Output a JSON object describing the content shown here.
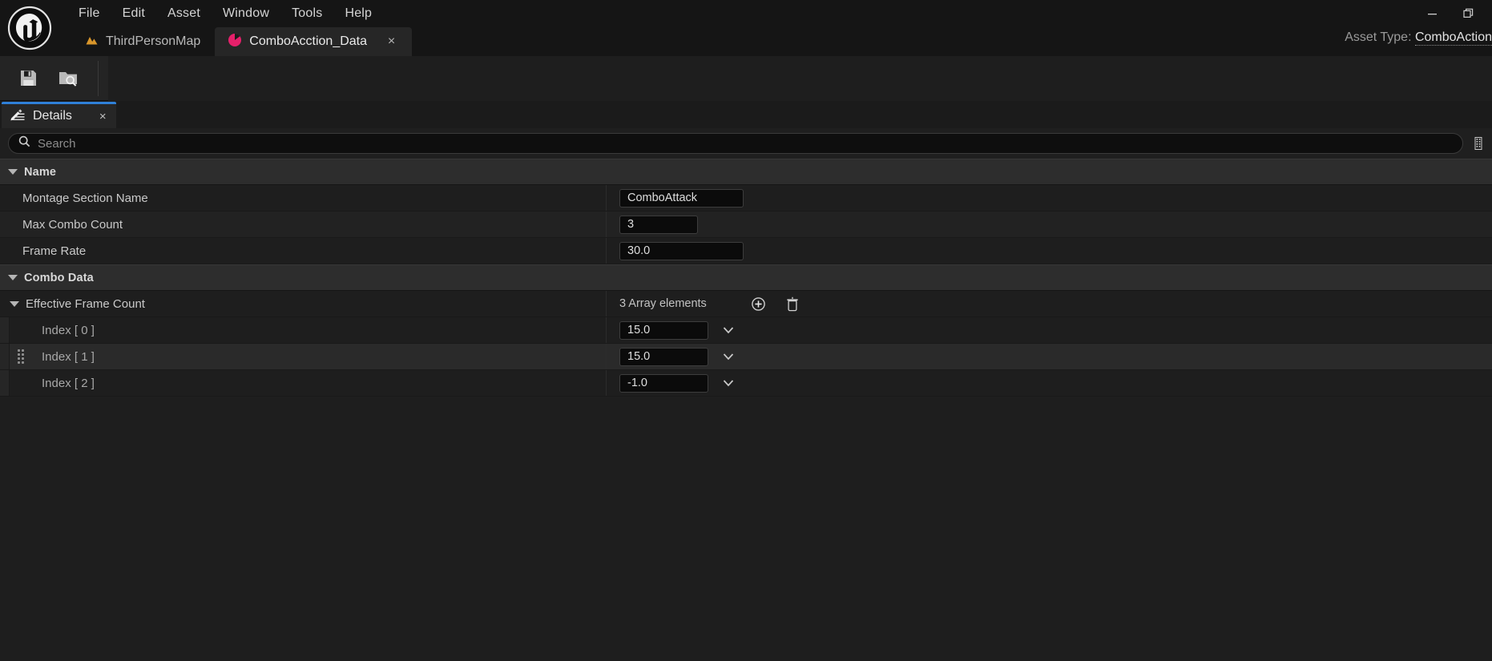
{
  "app": {
    "logo_alt": "unreal-engine-logo",
    "menu": [
      {
        "label": "File"
      },
      {
        "label": "Edit"
      },
      {
        "label": "Asset"
      },
      {
        "label": "Window"
      },
      {
        "label": "Tools"
      },
      {
        "label": "Help"
      }
    ],
    "tabs": [
      {
        "label": "ThirdPersonMap",
        "icon": "level-map-icon",
        "active": false,
        "closable": false
      },
      {
        "label": "ComboAcction_Data",
        "icon": "data-asset-icon",
        "active": true,
        "closable": true,
        "close_label": "×"
      }
    ],
    "window_controls": {
      "minimize": "—",
      "restore": "restore-icon",
      "close": "×"
    },
    "asset_type": {
      "prefix": "Asset Type: ",
      "value": "ComboAction"
    }
  },
  "toolbar": {
    "buttons": [
      {
        "name": "save-button",
        "icon": "save-icon",
        "tooltip": "Save"
      },
      {
        "name": "browse-button",
        "icon": "browse-content-icon",
        "tooltip": "Browse"
      }
    ]
  },
  "details_panel": {
    "tab_label": "Details",
    "tab_icon": "details-wrench-icon",
    "tab_close": "×",
    "search": {
      "placeholder": "Search",
      "value": "",
      "icon": "search-icon"
    },
    "settings_icon": "view-options-icon"
  },
  "sections": [
    {
      "title": "Name",
      "expanded": true,
      "rows": [
        {
          "label": "Montage Section Name",
          "value": "ComboAttack",
          "editor": "text"
        },
        {
          "label": "Max Combo Count",
          "value": "3",
          "editor": "number"
        },
        {
          "label": "Frame Rate",
          "value": "30.0",
          "editor": "number"
        }
      ]
    },
    {
      "title": "Combo Data",
      "expanded": true,
      "array": {
        "label": "Effective Frame Count",
        "expanded": true,
        "count_text": "3 Array elements",
        "add_icon": "add-element-icon",
        "delete_icon": "delete-all-elements-icon",
        "elements": [
          {
            "label": "Index [ 0 ]",
            "value": "15.0",
            "dropdown_icon": "chevron-down-icon",
            "hovered": false
          },
          {
            "label": "Index [ 1 ]",
            "value": "15.0",
            "dropdown_icon": "chevron-down-icon",
            "hovered": true
          },
          {
            "label": "Index [ 2 ]",
            "value": "-1.0",
            "dropdown_icon": "chevron-down-icon",
            "hovered": false
          }
        ]
      }
    }
  ],
  "colors": {
    "accent_tab": "#2f80d8",
    "asset_icon": "#e5206a",
    "map_icon": "#d9962b",
    "panel_bg": "#1e1e1e",
    "row_alt": "#222222",
    "section_bg": "#2d2d2d"
  }
}
